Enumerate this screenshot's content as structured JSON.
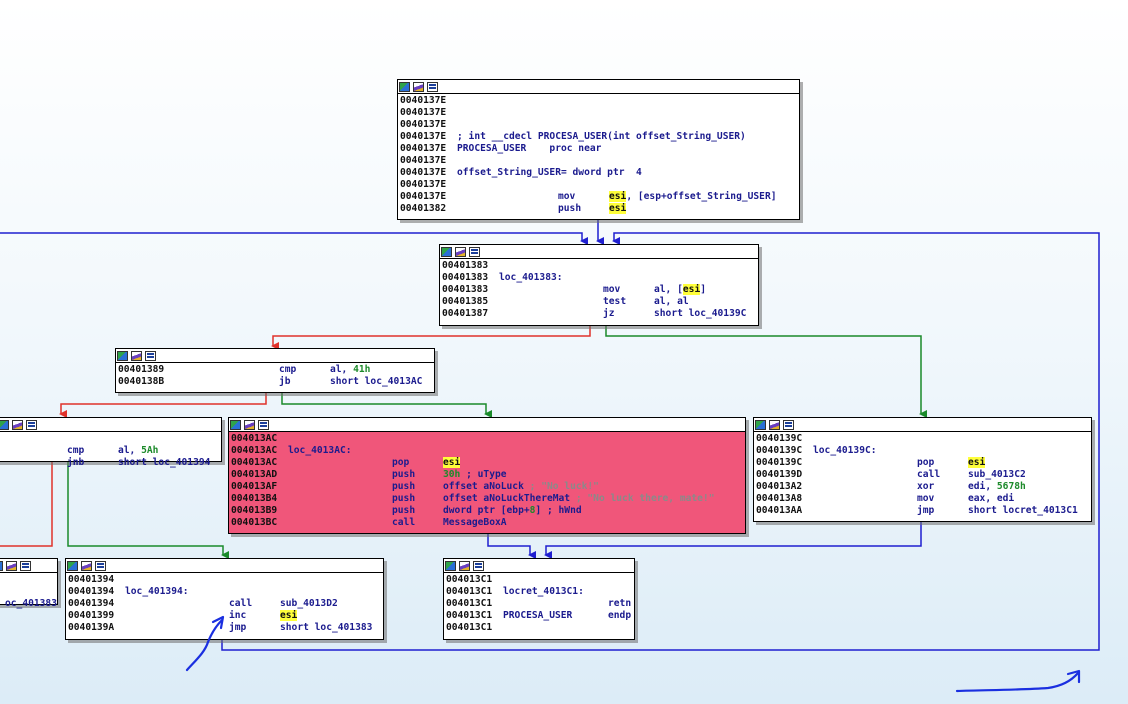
{
  "colors": {
    "edge_true": "#1a8a2a",
    "edge_false": "#e0322b",
    "edge_uncond": "#1f1fd0",
    "highlight_block": "#f0567a",
    "register_highlight": "#ffff3a",
    "annotation_ink": "#1a2fe0"
  },
  "icons": [
    "graph-overview-icon",
    "edit-block-icon",
    "xref-list-icon"
  ],
  "blocks": {
    "procesa_user": {
      "lines": [
        {
          "addr": "0040137E",
          "text": ""
        },
        {
          "addr": "0040137E",
          "text": ""
        },
        {
          "addr": "0040137E",
          "text": ""
        },
        {
          "addr": "0040137E",
          "text": "; int __cdecl PROCESA_USER(int offset_String_USER)"
        },
        {
          "addr": "0040137E",
          "text": "PROCESA_USER    proc near"
        },
        {
          "addr": "0040137E",
          "text": ""
        },
        {
          "addr": "0040137E",
          "text": "offset_String_USER= dword ptr  4"
        },
        {
          "addr": "0040137E",
          "text": ""
        },
        {
          "addr": "0040137E",
          "mn": "mov",
          "op_hl": "esi",
          "op": ", [esp+offset_String_USER]"
        },
        {
          "addr": "00401382",
          "mn": "push",
          "op_hl": "esi",
          "op": ""
        }
      ]
    },
    "loc_401383": {
      "lines": [
        {
          "addr": "00401383",
          "text": ""
        },
        {
          "addr": "00401383",
          "text": "loc_401383:"
        },
        {
          "addr": "00401383",
          "mn": "mov",
          "op": "al, [",
          "op_hl": "esi",
          "op2": "]"
        },
        {
          "addr": "00401385",
          "mn": "test",
          "op": "al, al"
        },
        {
          "addr": "00401387",
          "mn": "jz",
          "op": "short loc_40139C"
        }
      ]
    },
    "cmp_41h": {
      "lines": [
        {
          "addr": "00401389",
          "mn": "cmp",
          "op": "al, ",
          "num": "41h"
        },
        {
          "addr": "0040138B",
          "mn": "jb",
          "op": "short loc_4013AC"
        }
      ]
    },
    "cmp_5ah": {
      "lines": [
        {
          "addr": "",
          "text": ""
        },
        {
          "addr": "",
          "mn": "cmp",
          "op": "al, ",
          "num": "5Ah"
        },
        {
          "addr": "",
          "mn": "jnb",
          "op": "short loc_401394"
        }
      ]
    },
    "loc_4013ac": {
      "lines": [
        {
          "addr": "004013AC",
          "text": ""
        },
        {
          "addr": "004013AC",
          "text": "loc_4013AC:"
        },
        {
          "addr": "004013AC",
          "mn": "pop",
          "op_hl": "esi",
          "op": ""
        },
        {
          "addr": "004013AD",
          "mn": "push",
          "num": "30h",
          "op": " ; uType"
        },
        {
          "addr": "004013AF",
          "mn": "push",
          "op": "offset aNoLuck",
          "str": " ; \"No luck!\""
        },
        {
          "addr": "004013B4",
          "mn": "push",
          "op": "offset aNoLuckThereMat",
          "str": " ; \"No luck there, mate!\""
        },
        {
          "addr": "004013B9",
          "mn": "push",
          "op": "dword ptr [ebp+",
          "num": "8",
          "op2": "] ; hWnd"
        },
        {
          "addr": "004013BC",
          "mn": "call",
          "op": "MessageBoxA"
        }
      ]
    },
    "loc_40139c": {
      "lines": [
        {
          "addr": "0040139C",
          "text": ""
        },
        {
          "addr": "0040139C",
          "text": "loc_40139C:"
        },
        {
          "addr": "0040139C",
          "mn": "pop",
          "op_hl": "esi",
          "op": ""
        },
        {
          "addr": "0040139D",
          "mn": "call",
          "op": "sub_4013C2"
        },
        {
          "addr": "004013A2",
          "mn": "xor",
          "op": "edi, ",
          "num": "5678h"
        },
        {
          "addr": "004013A8",
          "mn": "mov",
          "op": "eax, edi"
        },
        {
          "addr": "004013AA",
          "mn": "jmp",
          "op": "short locret_4013C1"
        }
      ]
    },
    "stub_401383": {
      "lines": [
        {
          "addr": "",
          "text": ""
        },
        {
          "addr": "",
          "text": ""
        },
        {
          "addr": "",
          "text": "oc_401383"
        }
      ]
    },
    "loc_401394": {
      "lines": [
        {
          "addr": "00401394",
          "text": ""
        },
        {
          "addr": "00401394",
          "text": "loc_401394:"
        },
        {
          "addr": "00401394",
          "mn": "call",
          "op": "sub_4013D2"
        },
        {
          "addr": "00401399",
          "mn": "inc",
          "op_hl": "esi",
          "op": ""
        },
        {
          "addr": "0040139A",
          "mn": "jmp",
          "op": "short loc_401383"
        }
      ]
    },
    "locret_4013c1": {
      "lines": [
        {
          "addr": "004013C1",
          "text": ""
        },
        {
          "addr": "004013C1",
          "text": "locret_4013C1:"
        },
        {
          "addr": "004013C1",
          "mn": "retn",
          "op": ""
        },
        {
          "addr": "004013C1",
          "text": "PROCESA_USER",
          "mn": "endp",
          "op": ""
        },
        {
          "addr": "004013C1",
          "text": ""
        }
      ]
    }
  }
}
